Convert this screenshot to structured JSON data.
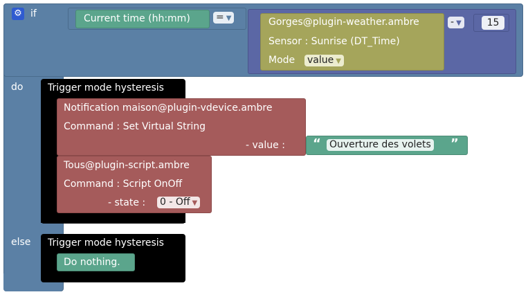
{
  "if_block": {
    "keyword_if": "if",
    "keyword_do": "do",
    "keyword_else": "else",
    "gear_icon": "gear-icon"
  },
  "condition": {
    "left": "Current time (hh:mm)",
    "operator": "=",
    "device": "Gorges@plugin-weather.ambre",
    "sensor": "Sensor : Sunrise (DT_Time)",
    "mode_label": "Mode",
    "mode_value": "value",
    "minus_op": "-",
    "number": "15"
  },
  "do_branch": {
    "trigger": "Trigger mode hysteresis",
    "notification": {
      "device": "Notification maison@plugin-vdevice.ambre",
      "command": "Command : Set Virtual String",
      "value_label": "- value :",
      "quote_open": "“",
      "quote_close": "”",
      "value_text": "Ouverture des volets"
    },
    "script": {
      "device": "Tous@plugin-script.ambre",
      "command": "Command : Script OnOff",
      "state_label": "- state :",
      "state_value": "0 - Off"
    }
  },
  "else_branch": {
    "trigger": "Trigger mode hysteresis",
    "action": "Do nothing."
  },
  "colors": {
    "if_block": "#5b80a5",
    "logic_green": "#5ba58c",
    "device_olive": "#a5a55b",
    "action_red": "#a55b5b",
    "trigger_black": "#000000",
    "math_blue": "#5b67a5"
  }
}
